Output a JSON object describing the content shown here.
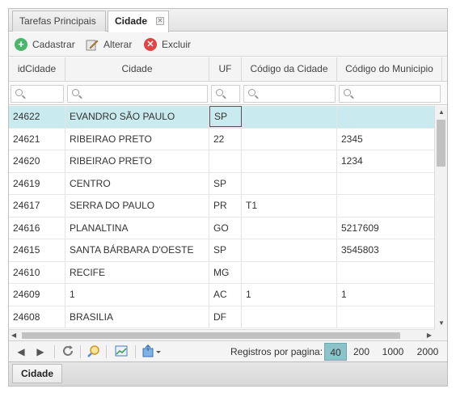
{
  "tabs": [
    {
      "label": "Tarefas Principais"
    },
    {
      "label": "Cidade"
    }
  ],
  "toolbar": {
    "add_label": "Cadastrar",
    "edit_label": "Alterar",
    "delete_label": "Excluir"
  },
  "grid": {
    "columns": [
      "idCidade",
      "Cidade",
      "UF",
      "Código da Cidade",
      "Código do Municipio"
    ],
    "rows": [
      {
        "id": "24622",
        "cidade": "EVANDRO SÃO PAULO",
        "uf": "SP",
        "cod_cidade": "",
        "cod_municipio": ""
      },
      {
        "id": "24621",
        "cidade": "RIBEIRAO PRETO",
        "uf": "22",
        "cod_cidade": "",
        "cod_municipio": "2345"
      },
      {
        "id": "24620",
        "cidade": "RIBEIRAO PRETO",
        "uf": "",
        "cod_cidade": "",
        "cod_municipio": "1234"
      },
      {
        "id": "24619",
        "cidade": "CENTRO",
        "uf": "SP",
        "cod_cidade": "",
        "cod_municipio": ""
      },
      {
        "id": "24617",
        "cidade": "SERRA DO PAULO",
        "uf": "PR",
        "cod_cidade": "T1",
        "cod_municipio": ""
      },
      {
        "id": "24616",
        "cidade": "PLANALTINA",
        "uf": "GO",
        "cod_cidade": "",
        "cod_municipio": "5217609"
      },
      {
        "id": "24615",
        "cidade": "SANTA BÁRBARA D'OESTE",
        "uf": "SP",
        "cod_cidade": "",
        "cod_municipio": "3545803"
      },
      {
        "id": "24610",
        "cidade": "RECIFE",
        "uf": "MG",
        "cod_cidade": "",
        "cod_municipio": ""
      },
      {
        "id": "24609",
        "cidade": "1",
        "uf": "AC",
        "cod_cidade": "1",
        "cod_municipio": "1"
      },
      {
        "id": "24608",
        "cidade": "BRASILIA",
        "uf": "DF",
        "cod_cidade": "",
        "cod_municipio": ""
      }
    ]
  },
  "pager": {
    "label": "Registros por pagina:",
    "options": [
      "40",
      "200",
      "1000",
      "2000"
    ],
    "selected": "40"
  },
  "bottom_tab": {
    "label": "Cidade"
  },
  "colors": {
    "selected_row": "#c9eaee",
    "active_page": "#8cc3c9"
  },
  "icons": [
    "close-icon",
    "add-icon",
    "edit-icon",
    "delete-icon",
    "search-icon",
    "prev-icon",
    "next-icon",
    "refresh-icon",
    "zoom-icon",
    "chart-icon",
    "export-icon"
  ]
}
